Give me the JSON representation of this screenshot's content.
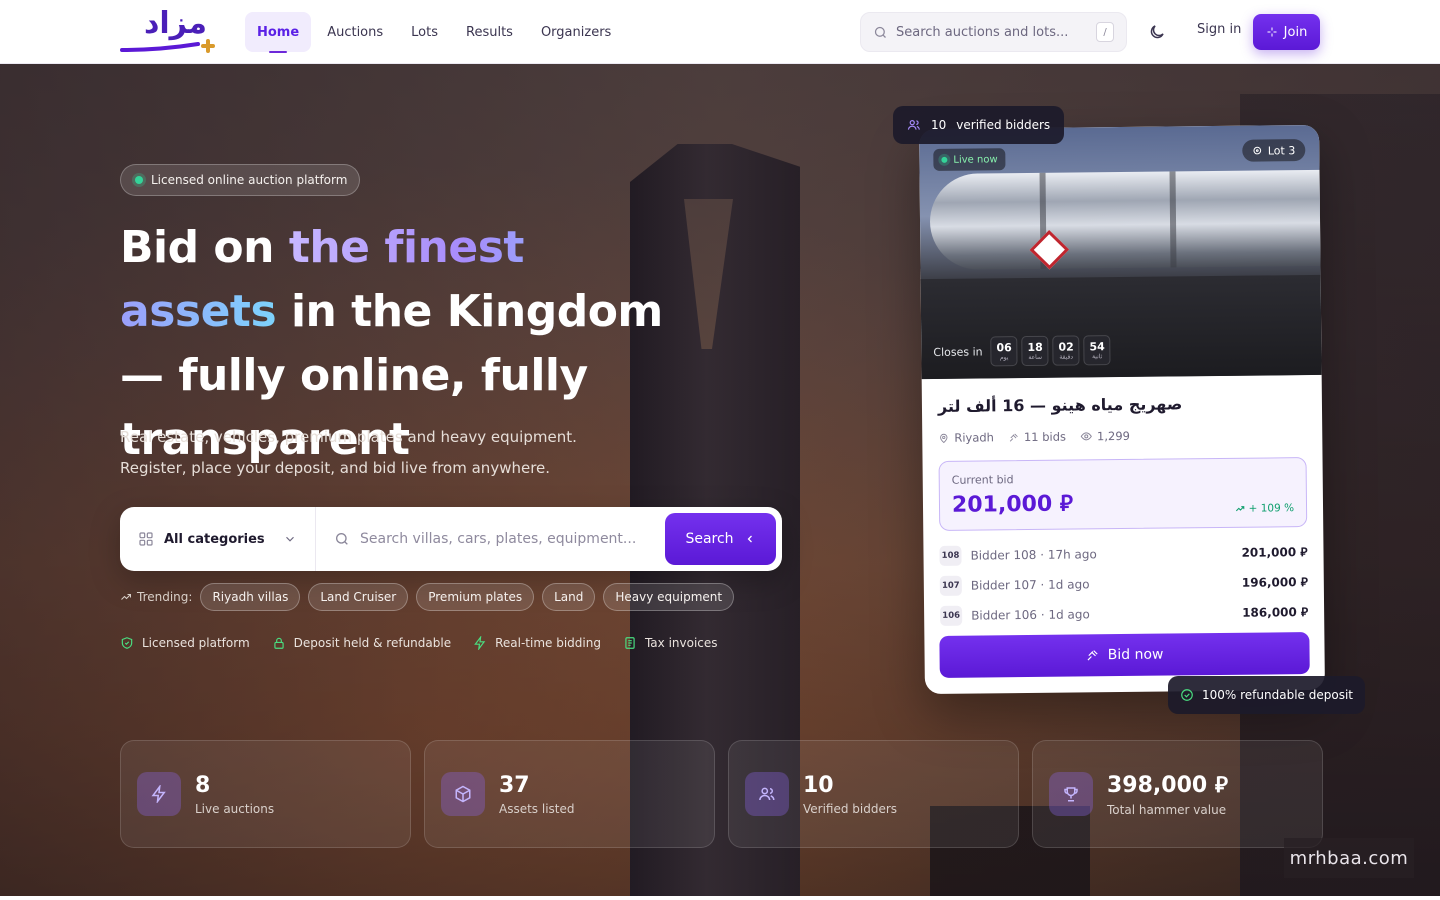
{
  "brand": {
    "logo_text": "مزاد"
  },
  "nav": {
    "items": [
      {
        "label": "Home",
        "active": true
      },
      {
        "label": "Auctions",
        "active": false
      },
      {
        "label": "Lots",
        "active": false
      },
      {
        "label": "Results",
        "active": false
      },
      {
        "label": "Organizers",
        "active": false
      }
    ]
  },
  "header_search": {
    "placeholder": "Search auctions and lots...",
    "shortcut": "/"
  },
  "header_actions": {
    "theme_icon": "moon-icon",
    "sign_in": "Sign in",
    "join": "Join"
  },
  "hero": {
    "pill": "Licensed online auction platform",
    "headline_before": "Bid on ",
    "headline_highlight": "the finest assets",
    "headline_after": " in the Kingdom — fully online, fully transparent",
    "subtext": "Real estate, vehicles, premium plates and heavy equipment. Register, place your deposit, and bid live from anywhere.",
    "search": {
      "category": "All categories",
      "placeholder": "Search villas, cars, plates, equipment...",
      "button": "Search"
    },
    "trending_label": "Trending:",
    "trending": [
      "Riyadh villas",
      "Land Cruiser",
      "Premium plates",
      "Land",
      "Heavy equipment"
    ],
    "trust": [
      {
        "icon": "shield-check-icon",
        "label": "Licensed platform"
      },
      {
        "icon": "lock-icon",
        "label": "Deposit held & refundable"
      },
      {
        "icon": "bolt-icon",
        "label": "Real-time bidding"
      },
      {
        "icon": "invoice-icon",
        "label": "Tax invoices"
      }
    ]
  },
  "lot_card": {
    "bidders_badge": {
      "count": "10",
      "label": "verified bidders"
    },
    "live_tag": "Live now",
    "lot_tag": "Lot 3",
    "closes_label": "Closes in",
    "countdown": [
      {
        "value": "06",
        "unit": "يوم"
      },
      {
        "value": "18",
        "unit": "ساعة"
      },
      {
        "value": "02",
        "unit": "دقيقة"
      },
      {
        "value": "54",
        "unit": "ثانية"
      }
    ],
    "title": "صهريج مياه هينو — 16 ألف لتر",
    "location": "Riyadh",
    "bids": "11 bids",
    "views": "1,299",
    "current_bid_label": "Current bid",
    "current_bid": "201,000 ⃁",
    "change": "+ 109 %",
    "history": [
      {
        "num": "108",
        "who": "Bidder 108 · 17h ago",
        "amount": "201,000 ⃁"
      },
      {
        "num": "107",
        "who": "Bidder 107 · 1d ago",
        "amount": "196,000 ⃁"
      },
      {
        "num": "106",
        "who": "Bidder 106 · 1d ago",
        "amount": "186,000 ⃁"
      }
    ],
    "bid_button": "Bid now",
    "deposit_badge": "100% refundable deposit"
  },
  "stats": [
    {
      "icon": "bolt-icon",
      "value": "8",
      "label": "Live auctions"
    },
    {
      "icon": "cube-icon",
      "value": "37",
      "label": "Assets listed"
    },
    {
      "icon": "users-icon",
      "value": "10",
      "label": "Verified bidders"
    },
    {
      "icon": "trophy-icon",
      "value": "398,000 ⃁",
      "label": "Total hammer value"
    }
  ],
  "watermark": "mrhbaa.com",
  "colors": {
    "brand": "#5b19d6",
    "accent_gold": "#d99a2b",
    "success": "#0f9f6e"
  }
}
